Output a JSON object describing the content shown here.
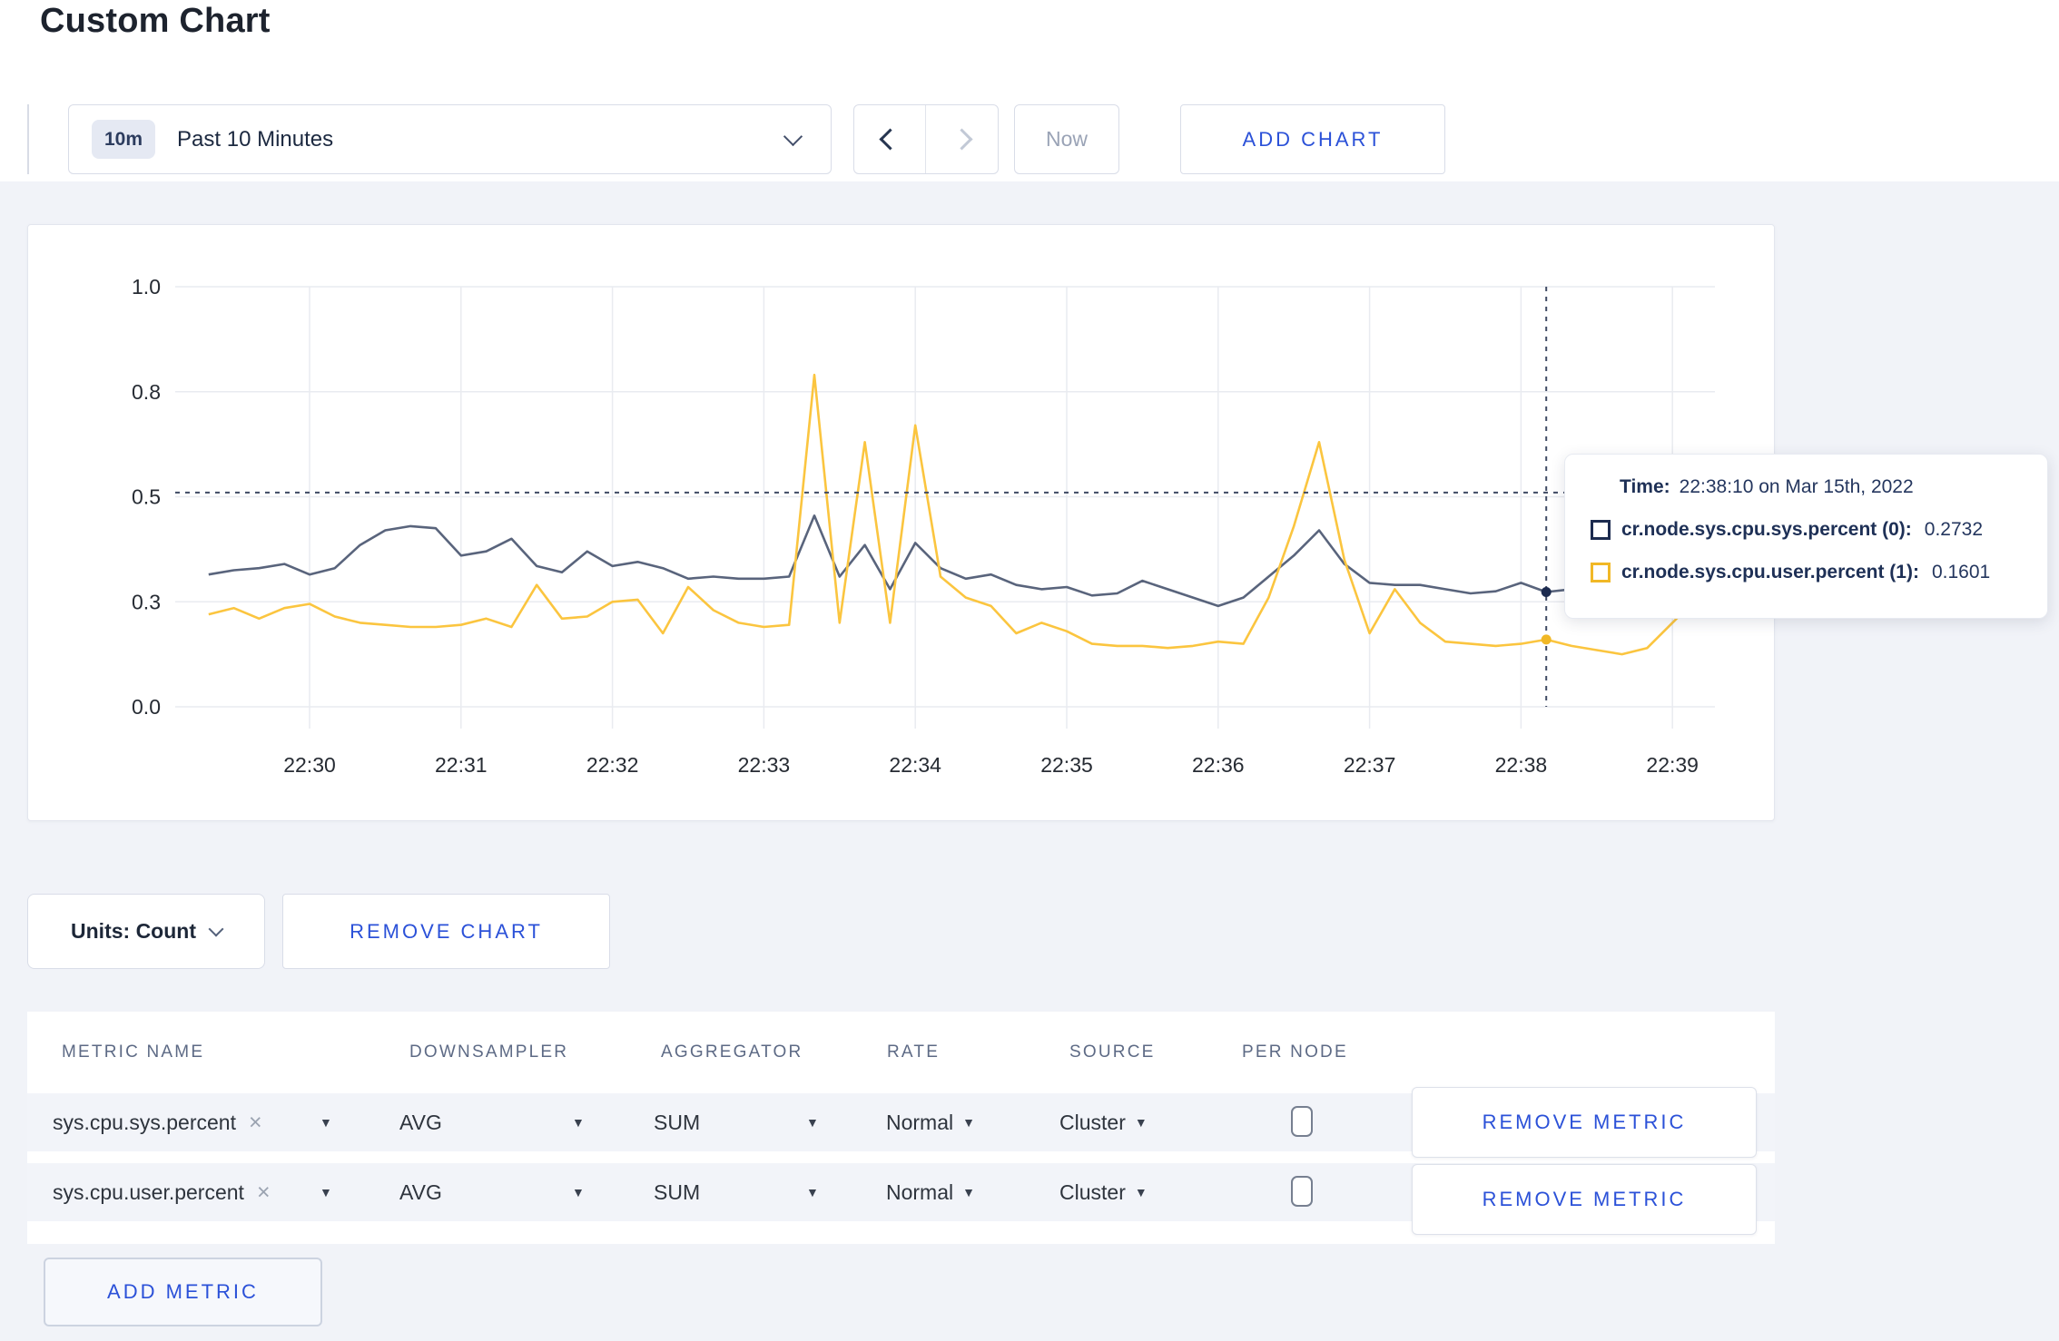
{
  "page": {
    "title": "Custom Chart"
  },
  "toolbar": {
    "timeframe_badge": "10m",
    "timeframe_label": "Past 10 Minutes",
    "now_label": "Now",
    "add_chart_label": "ADD CHART"
  },
  "tooltip": {
    "time_label": "Time:",
    "time_value": "22:38:10 on Mar 15th, 2022",
    "rows": [
      {
        "name": "cr.node.sys.cpu.sys.percent (0):",
        "value": "0.2732"
      },
      {
        "name": "cr.node.sys.cpu.user.percent (1):",
        "value": "0.1601"
      }
    ]
  },
  "units_row": {
    "units_label": "Units: Count",
    "remove_chart_label": "REMOVE CHART"
  },
  "metrics_table": {
    "headers": [
      "METRIC NAME",
      "DOWNSAMPLER",
      "AGGREGATOR",
      "RATE",
      "SOURCE",
      "PER NODE"
    ],
    "remove_icon": "×",
    "caret_icon": "▼",
    "rows": [
      {
        "name": "sys.cpu.sys.percent",
        "downsampler": "AVG",
        "aggregator": "SUM",
        "rate": "Normal",
        "source": "Cluster",
        "per_node_checked": false,
        "remove_label": "REMOVE METRIC"
      },
      {
        "name": "sys.cpu.user.percent",
        "downsampler": "AVG",
        "aggregator": "SUM",
        "rate": "Normal",
        "source": "Cluster",
        "per_node_checked": false,
        "remove_label": "REMOVE METRIC"
      }
    ],
    "add_metric_label": "ADD METRIC"
  },
  "chart_data": {
    "type": "line",
    "ylim": [
      0,
      1
    ],
    "grid": true,
    "legend_position": "tooltip",
    "y_ticks": [
      {
        "value": 1.0,
        "label": "1.0"
      },
      {
        "value": 0.75,
        "label": "0.8"
      },
      {
        "value": 0.5,
        "label": "0.5"
      },
      {
        "value": 0.25,
        "label": "0.3"
      },
      {
        "value": 0.0,
        "label": "0.0"
      }
    ],
    "x_ticks": [
      "22:30",
      "22:31",
      "22:32",
      "22:33",
      "22:34",
      "22:35",
      "22:36",
      "22:37",
      "22:38",
      "22:39"
    ],
    "times": [
      "22:29:20",
      "22:29:30",
      "22:29:40",
      "22:29:50",
      "22:30:00",
      "22:30:10",
      "22:30:20",
      "22:30:30",
      "22:30:40",
      "22:30:50",
      "22:31:00",
      "22:31:10",
      "22:31:20",
      "22:31:30",
      "22:31:40",
      "22:31:50",
      "22:32:00",
      "22:32:10",
      "22:32:20",
      "22:32:30",
      "22:32:40",
      "22:32:50",
      "22:33:00",
      "22:33:10",
      "22:33:20",
      "22:33:30",
      "22:33:40",
      "22:33:50",
      "22:34:00",
      "22:34:10",
      "22:34:20",
      "22:34:30",
      "22:34:40",
      "22:34:50",
      "22:35:00",
      "22:35:10",
      "22:35:20",
      "22:35:30",
      "22:35:40",
      "22:35:50",
      "22:36:00",
      "22:36:10",
      "22:36:20",
      "22:36:30",
      "22:36:40",
      "22:36:50",
      "22:37:00",
      "22:37:10",
      "22:37:20",
      "22:37:30",
      "22:37:40",
      "22:37:50",
      "22:38:00",
      "22:38:10",
      "22:38:20",
      "22:38:30",
      "22:38:40",
      "22:38:50",
      "22:39:00",
      "22:39:10"
    ],
    "series": [
      {
        "name": "cr.node.sys.cpu.sys.percent",
        "color": "#59647c",
        "swatch": "#1c2b4f",
        "values": [
          0.315,
          0.325,
          0.33,
          0.34,
          0.315,
          0.33,
          0.385,
          0.42,
          0.43,
          0.425,
          0.36,
          0.37,
          0.4,
          0.335,
          0.32,
          0.37,
          0.335,
          0.345,
          0.33,
          0.305,
          0.31,
          0.305,
          0.305,
          0.31,
          0.455,
          0.31,
          0.385,
          0.28,
          0.39,
          0.33,
          0.305,
          0.315,
          0.29,
          0.28,
          0.285,
          0.265,
          0.27,
          0.3,
          0.28,
          0.26,
          0.24,
          0.26,
          0.31,
          0.36,
          0.42,
          0.34,
          0.295,
          0.29,
          0.29,
          0.28,
          0.27,
          0.275,
          0.295,
          0.2732,
          0.28,
          0.285,
          0.28,
          0.27,
          0.28,
          0.28
        ]
      },
      {
        "name": "cr.node.sys.cpu.user.percent",
        "color": "#fbc53f",
        "swatch": "#f1b826",
        "values": [
          0.22,
          0.235,
          0.21,
          0.235,
          0.245,
          0.215,
          0.2,
          0.195,
          0.19,
          0.19,
          0.195,
          0.21,
          0.19,
          0.29,
          0.21,
          0.215,
          0.25,
          0.255,
          0.175,
          0.285,
          0.23,
          0.2,
          0.19,
          0.195,
          0.79,
          0.2,
          0.63,
          0.2,
          0.67,
          0.31,
          0.26,
          0.24,
          0.175,
          0.2,
          0.18,
          0.15,
          0.145,
          0.145,
          0.14,
          0.145,
          0.155,
          0.15,
          0.26,
          0.43,
          0.63,
          0.35,
          0.175,
          0.28,
          0.2,
          0.155,
          0.15,
          0.145,
          0.15,
          0.1601,
          0.145,
          0.135,
          0.125,
          0.14,
          0.2,
          0.26
        ]
      }
    ],
    "crosshair": {
      "time": "22:38:10",
      "hover_value": 0.51
    }
  }
}
